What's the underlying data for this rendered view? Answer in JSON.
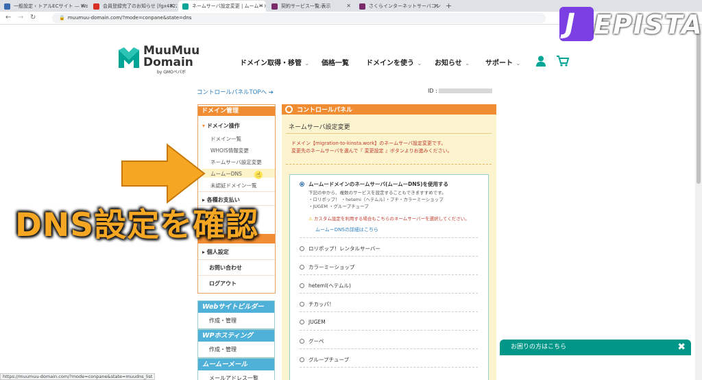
{
  "browser": {
    "tabs": [
      {
        "label": "一般設定 ‹ トアルECサイト — Wor..."
      },
      {
        "label": "会員登録完了のお知らせ [fgx4822..."
      },
      {
        "label": "ネームサーバ設定変更 | ムームードメイン"
      },
      {
        "label": "契約サービス一覧:表示"
      },
      {
        "label": "さくらインターネットサーバコントロールパ..."
      }
    ],
    "url": "muumuu-domain.com/?mode=conpane&state=dns",
    "status_url": "https://muumuu-domain.com/?mode=conpane&state=muudns_list"
  },
  "watermark": {
    "text": "JEPISTA",
    "j": "J"
  },
  "site": {
    "logo_line1": "MuuMuu",
    "logo_line2": "Domain",
    "logo_sub": "by GMOペパボ",
    "nav": [
      {
        "label": "ドメイン取得・移管"
      },
      {
        "label": "価格一覧"
      },
      {
        "label": "ドメインを使う"
      },
      {
        "label": "お知らせ"
      },
      {
        "label": "サポート"
      }
    ]
  },
  "cp_top_link": "コントロールパネルTOPへ ➔",
  "id_label": "ID :",
  "left_menu": {
    "header": "ドメイン管理",
    "section1": "▾ ドメイン操作",
    "items": [
      "ドメイン一覧",
      "WHOIS情報変更",
      "ネームサーバ設定変更",
      "ムームーDNS",
      "未認証ドメイン一覧"
    ],
    "section2": "▸ 各種お支払い",
    "partial1": "汎",
    "partial2": "確",
    "section3": "▸ 個人設定",
    "contact": "お問い合わせ",
    "logout": "ログアウト"
  },
  "blue_boxes": [
    {
      "title": "Webサイトビルダー",
      "link": "作成・管理"
    },
    {
      "title": "WPホスティング",
      "link": "作成・管理"
    },
    {
      "title": "ムームーメール",
      "link": "メールアドレス一覧"
    }
  ],
  "panel": {
    "header": "コントロールパネル",
    "title": "ネームサーバ設定変更",
    "desc1": "ドメイン【migration-to-kinsta.work】のネームサーバ設定変更です。",
    "desc2": "変更先のネームサーバを選んで『 変更設定 』ボタンよりお進みください。",
    "selected_option": "ムームードメインのネームサーバ(ムームーDNS)を使用する",
    "sub1": "下記の中から、複数のサービスを設定することもできますすめです。",
    "sub2": "・ロリポップ！ ・hetemi（ヘテムル）・プチ・カラーミーショップ",
    "sub3": "・JUGEM ・グループチューブ",
    "warning": "カスタム設定を利用する場合もこちらのネームサーバーを選択してください。",
    "detail_link": "ムームーDNSの詳細はこちら",
    "options": [
      "ロリポップ！レンタルサーバー",
      "カラーミーショップ",
      "heteml(ヘテムル)",
      "チカッパ！",
      "JUGEM",
      "グーペ",
      "グループチューブ"
    ]
  },
  "overlay": "DNS設定を確認",
  "help": {
    "label": "お困りの方はこちら",
    "close": "✖"
  },
  "colors": {
    "accent": "#f08c32",
    "brand": "#00a596",
    "arrow": "#f5a623",
    "help": "#009688"
  }
}
